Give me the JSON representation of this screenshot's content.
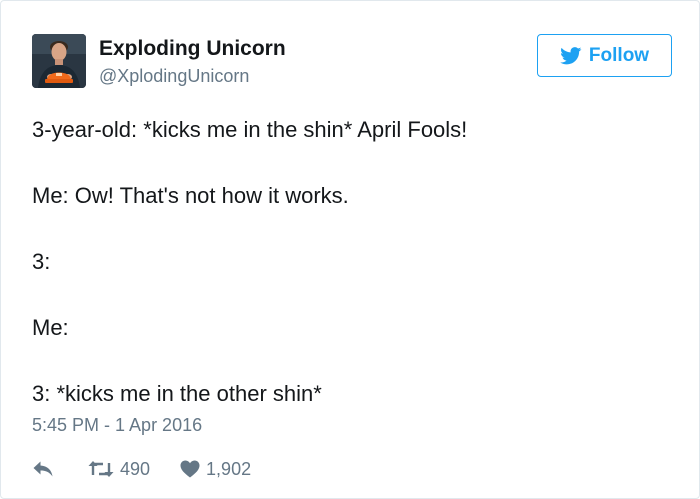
{
  "user": {
    "name": "Exploding Unicorn",
    "handle": "@XplodingUnicorn"
  },
  "follow_button": {
    "label": "Follow",
    "icon": "twitter-bird-icon"
  },
  "tweet": {
    "lines": [
      "3-year-old: *kicks me in the shin* April Fools!",
      "Me: Ow! That's not how it works.",
      "3:",
      "Me:",
      "3: *kicks me in the other shin*"
    ],
    "timestamp": "5:45 PM - 1 Apr 2016"
  },
  "actions": {
    "reply": {
      "icon": "reply-icon"
    },
    "retweet": {
      "icon": "retweet-icon",
      "count": "490"
    },
    "like": {
      "icon": "heart-icon",
      "count": "1,902"
    }
  },
  "colors": {
    "accent": "#1da1f2",
    "text": "#14171a",
    "secondary": "#657786",
    "border": "#e1e8ed"
  }
}
